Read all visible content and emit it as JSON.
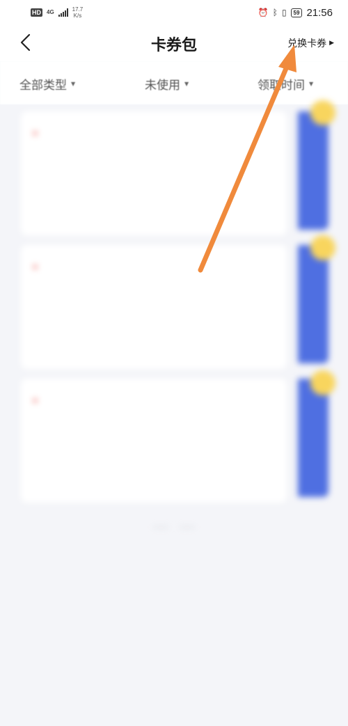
{
  "status_bar": {
    "hd": "HD",
    "network": "4G",
    "speed_value": "17.7",
    "speed_unit": "K/s",
    "battery": "59",
    "time": "21:56"
  },
  "header": {
    "title": "卡券包",
    "redeem_label": "兑换卡券"
  },
  "filters": [
    {
      "label": "全部类型"
    },
    {
      "label": "未使用"
    },
    {
      "label": "领取时间"
    }
  ],
  "cards": [
    {
      "type": "",
      "date": "",
      "title_highlight": "",
      "title_rest": "",
      "description": "",
      "action": ""
    },
    {
      "type": "",
      "date": "",
      "title_highlight": "",
      "title_rest": "",
      "description": "",
      "action": ""
    },
    {
      "type": "",
      "date": "",
      "title_highlight": "",
      "title_rest": "",
      "description": "",
      "action": ""
    }
  ],
  "list_end_text": "",
  "bottom_hint": "",
  "colors": {
    "accent_blue": "#4f6fe1",
    "highlight_red": "#e8463c",
    "badge_yellow": "#f8d55e",
    "annotation_orange": "#f08a3c"
  }
}
